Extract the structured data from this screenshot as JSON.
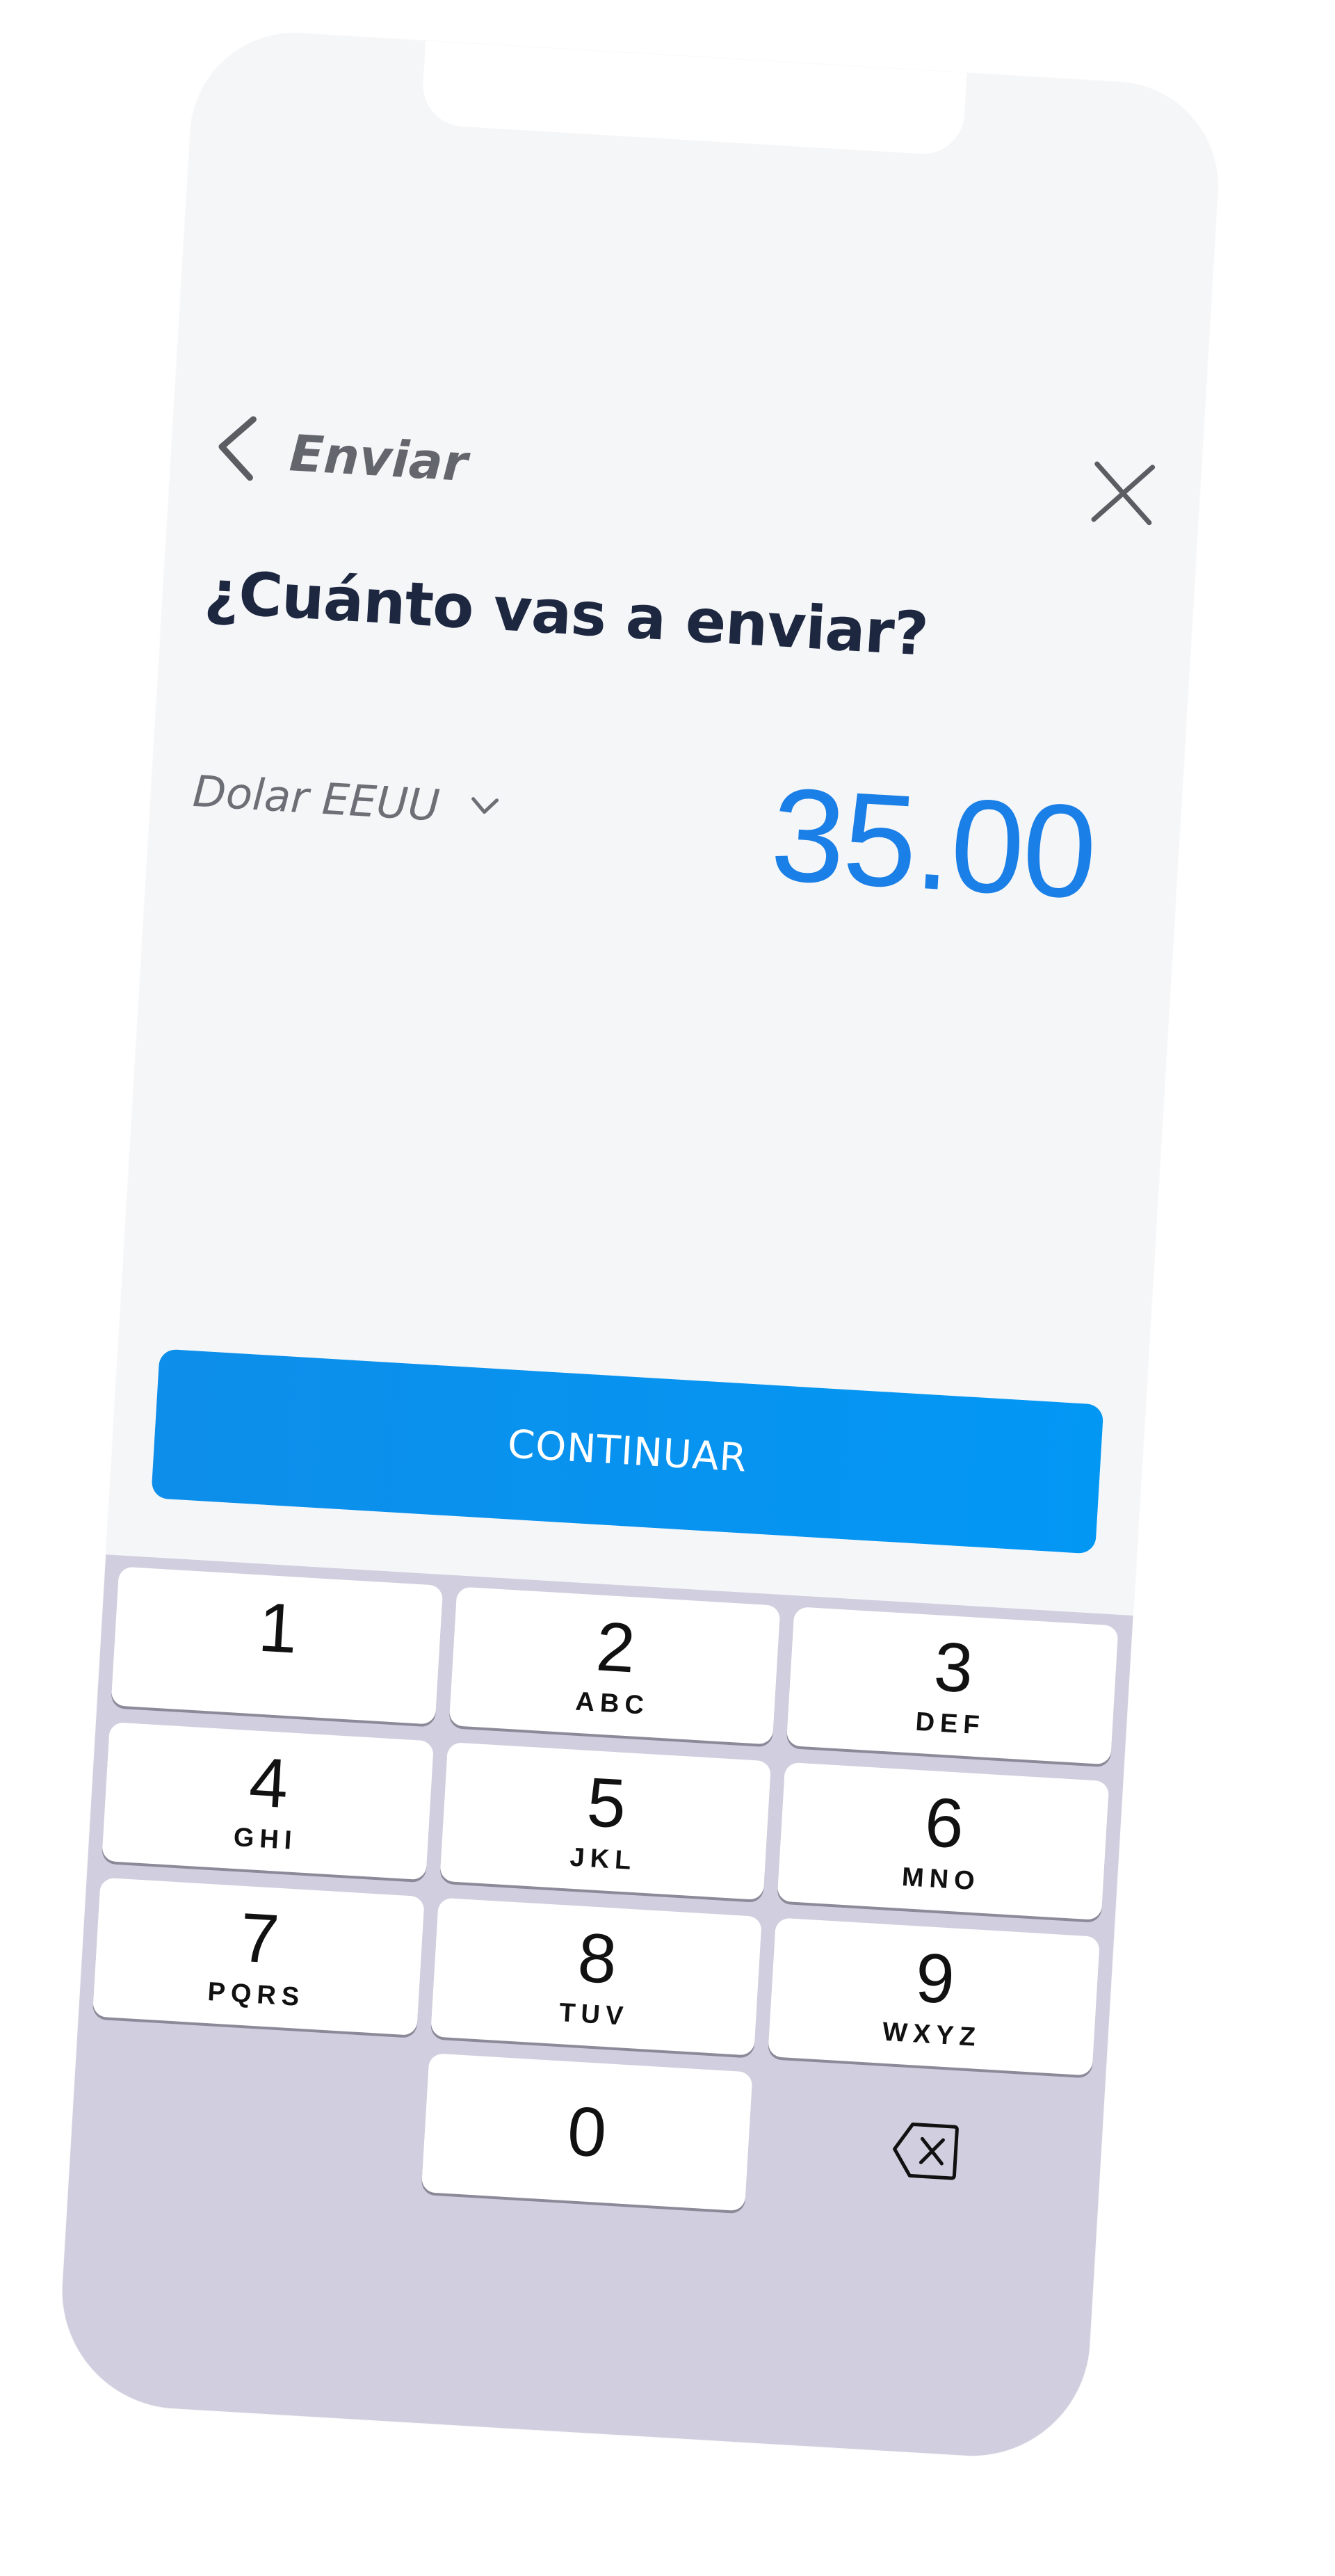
{
  "header": {
    "back_label": "Enviar",
    "back_icon": "chevron-left-icon",
    "close_icon": "close-icon"
  },
  "main": {
    "question": "¿Cuánto vas a enviar?",
    "currency_label": "Dolar EEUU",
    "currency_icon": "chevron-down-icon",
    "amount": "35.00",
    "continue_label": "CONTINUAR"
  },
  "colors": {
    "accent": "#1a7fe6",
    "button": "#0397f4",
    "heading": "#1d2740",
    "keyboard_bg": "#d1cfdf"
  },
  "keypad": {
    "keys": [
      {
        "digit": "1",
        "letters": ""
      },
      {
        "digit": "2",
        "letters": "ABC"
      },
      {
        "digit": "3",
        "letters": "DEF"
      },
      {
        "digit": "4",
        "letters": "GHI"
      },
      {
        "digit": "5",
        "letters": "JKL"
      },
      {
        "digit": "6",
        "letters": "MNO"
      },
      {
        "digit": "7",
        "letters": "PQRS"
      },
      {
        "digit": "8",
        "letters": "TUV"
      },
      {
        "digit": "9",
        "letters": "WXYZ"
      },
      {
        "digit": "0",
        "letters": ""
      }
    ],
    "delete_icon": "backspace-icon"
  }
}
